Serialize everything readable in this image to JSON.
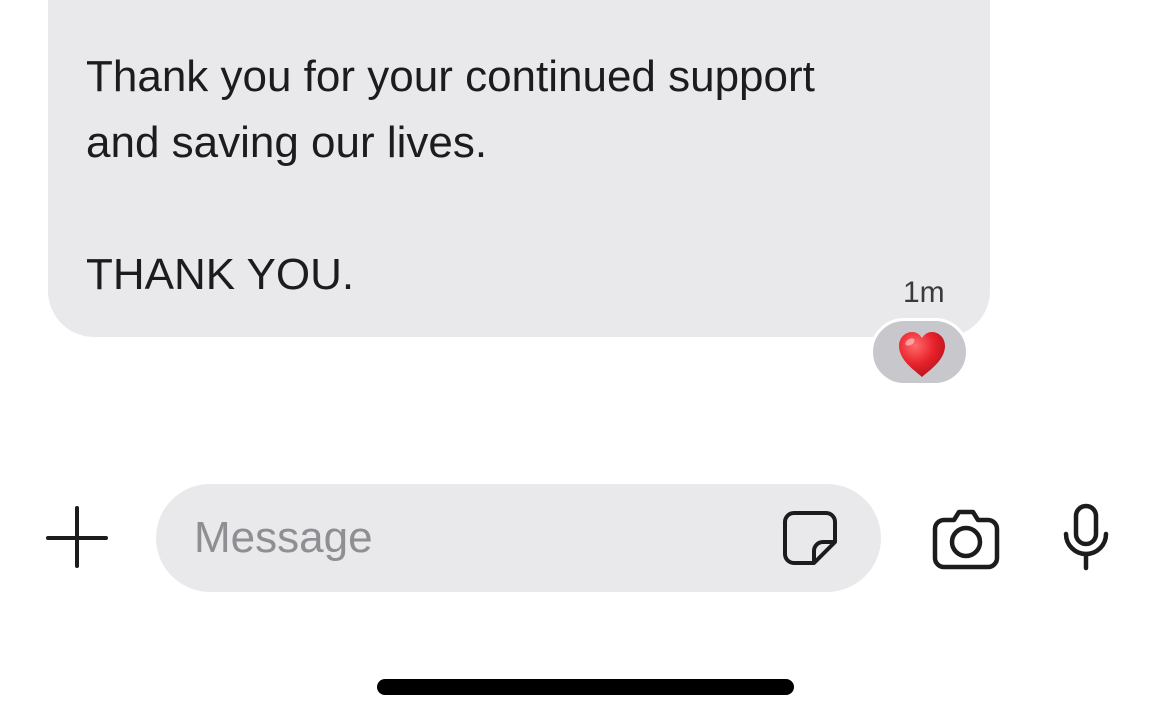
{
  "message": {
    "lines": [
      "Thank you for your continued support",
      "and saving our lives.",
      "THANK YOU."
    ],
    "timestamp": "1m",
    "reaction": "heart-emoji"
  },
  "composer": {
    "placeholder": "Message",
    "value": ""
  },
  "icons": {
    "add": "plus-icon",
    "sticker": "sticker-icon",
    "camera": "camera-icon",
    "microphone": "microphone-icon"
  },
  "colors": {
    "bubble_background": "#e9e9eb",
    "composer_background": "#e9e9eb",
    "reaction_pill_background": "#c7c7cc",
    "heart": "#e8222b",
    "icon_stroke": "#1c1c1e",
    "placeholder_text": "#8e8e93"
  }
}
